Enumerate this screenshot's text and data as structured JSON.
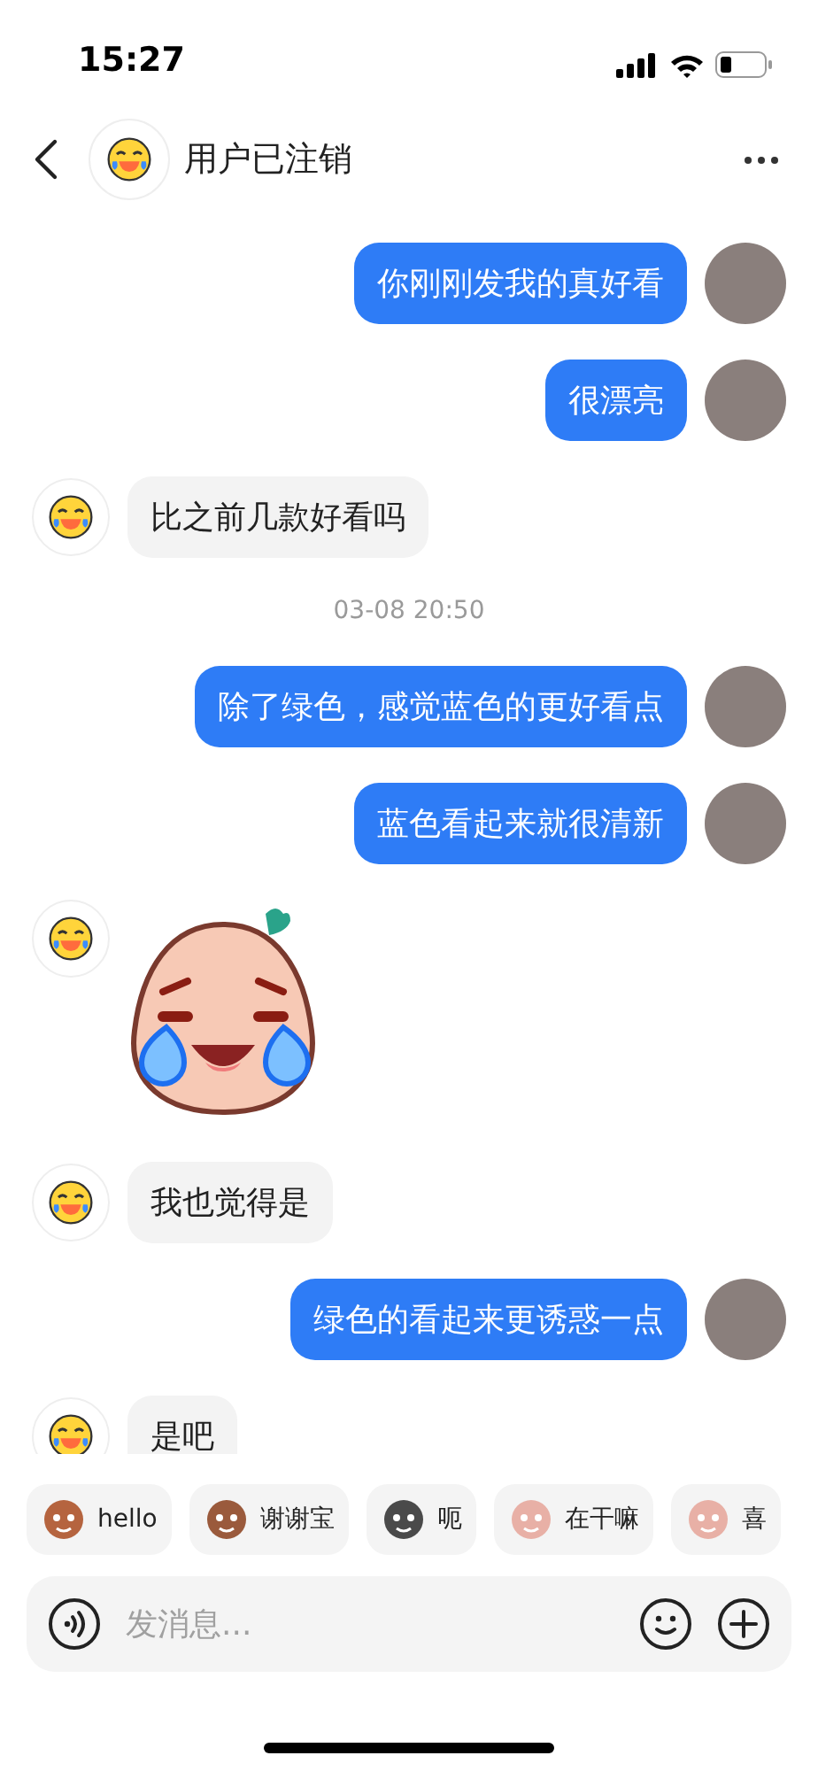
{
  "status_bar": {
    "time": "15:27"
  },
  "header": {
    "title": "用户已注销"
  },
  "messages": [
    {
      "kind": "sent",
      "text": "你刚刚发我的真好看"
    },
    {
      "kind": "sent",
      "text": "很漂亮"
    },
    {
      "kind": "received",
      "text": "比之前几款好看吗"
    },
    {
      "kind": "time",
      "text": "03-08 20:50"
    },
    {
      "kind": "sent",
      "text": "除了绿色，感觉蓝色的更好看点"
    },
    {
      "kind": "sent",
      "text": "蓝色看起来就很清新"
    },
    {
      "kind": "sticker"
    },
    {
      "kind": "received",
      "text": "我也觉得是"
    },
    {
      "kind": "sent",
      "text": "绿色的看起来更诱惑一点"
    },
    {
      "kind": "received",
      "text": "是吧"
    }
  ],
  "quick_replies": [
    {
      "label": "hello"
    },
    {
      "label": "谢谢宝"
    },
    {
      "label": "呃"
    },
    {
      "label": "在干嘛"
    },
    {
      "label": "喜"
    }
  ],
  "input": {
    "placeholder": "发消息..."
  }
}
